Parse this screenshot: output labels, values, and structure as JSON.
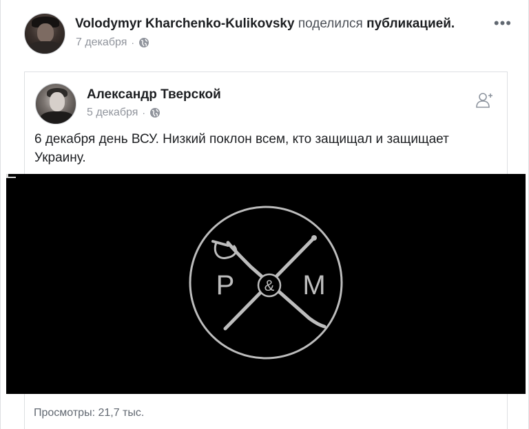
{
  "outer_post": {
    "author": "Volodymyr Kharchenko-Kulikovsky",
    "action_verb": "поделился",
    "action_object": "публикацией.",
    "date": "7 декабря",
    "separator": "·",
    "privacy_icon": "globe-icon",
    "more_icon": "more-options-icon",
    "more_label": "•••"
  },
  "shared_post": {
    "author": "Александр Тверской",
    "date": "5 декабря",
    "separator": "·",
    "privacy_icon": "globe-icon",
    "add_friend_icon": "add-friend-icon",
    "text": "6 декабря день ВСУ. Низкий поклон всем, кто защищал и защищает Украину."
  },
  "video": {
    "logo": {
      "left_letter": "P",
      "center_mark": "&",
      "right_letter": "M"
    }
  },
  "stats": {
    "views": "Просмотры: 21,7 тыс."
  },
  "colors": {
    "name_text": "#1c1e21",
    "meta_text": "#90949c",
    "video_bg": "#000000",
    "logo_stroke": "#bdbdbd"
  }
}
